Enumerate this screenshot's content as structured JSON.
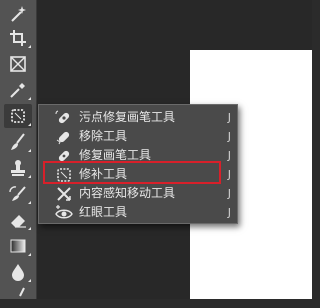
{
  "toolbar": {
    "tools": [
      {
        "icon": "magic-wand-icon"
      },
      {
        "icon": "crop-icon"
      },
      {
        "icon": "frame-icon"
      },
      {
        "icon": "eyedropper-icon"
      },
      {
        "icon": "patch-icon",
        "active": true
      },
      {
        "icon": "brush-icon"
      },
      {
        "icon": "stamp-icon"
      },
      {
        "icon": "history-brush-icon"
      },
      {
        "icon": "eraser-icon"
      },
      {
        "icon": "gradient-icon"
      },
      {
        "icon": "blur-drop-icon"
      },
      {
        "icon": "dodge-icon"
      }
    ]
  },
  "flyout": {
    "items": [
      {
        "label": "污点修复画笔工具",
        "shortcut": "J",
        "icon": "spot-healing-brush-icon",
        "selected": false
      },
      {
        "label": "移除工具",
        "shortcut": "J",
        "icon": "remove-tool-icon",
        "selected": false
      },
      {
        "label": "修复画笔工具",
        "shortcut": "J",
        "icon": "healing-brush-icon",
        "selected": false
      },
      {
        "label": "修补工具",
        "shortcut": "J",
        "icon": "patch-icon",
        "selected": true
      },
      {
        "label": "内容感知移动工具",
        "shortcut": "J",
        "icon": "content-aware-move-icon",
        "selected": false
      },
      {
        "label": "红眼工具",
        "shortcut": "J",
        "icon": "red-eye-icon",
        "selected": false
      }
    ]
  },
  "colors": {
    "highlight": "#d8202a",
    "toolbar_bg": "#535353",
    "menu_bg": "#4a4a4a"
  }
}
